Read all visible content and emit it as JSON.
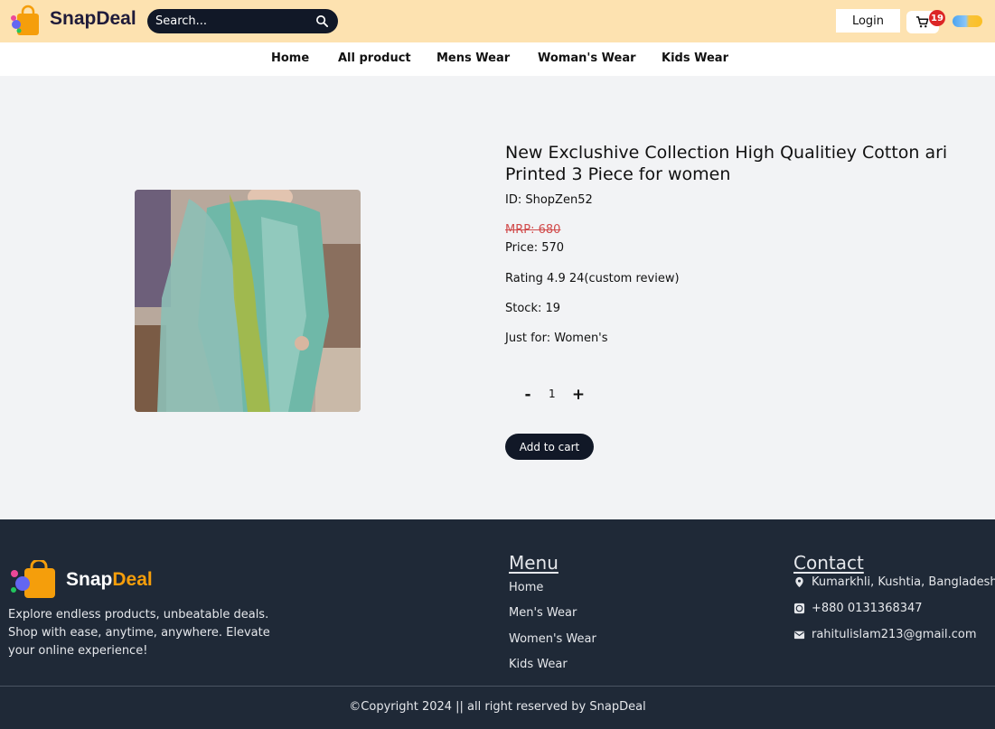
{
  "header": {
    "brand": "SnapDeal",
    "search_placeholder": "Search...",
    "login_label": "Login",
    "cart_count": "19",
    "colors": {
      "background": "#fde2b0",
      "search_bg": "#111827",
      "badge": "#dc2626"
    }
  },
  "nav": {
    "items": [
      {
        "label": "Home"
      },
      {
        "label": "All product"
      },
      {
        "label": "Mens Wear"
      },
      {
        "label": "Woman's Wear"
      },
      {
        "label": "Kids Wear"
      }
    ]
  },
  "product": {
    "title": "New Exclushive Collection High Qualitiey Cotton ari Printed 3 Piece for women",
    "id": "ID: ShopZen52",
    "mrp": "MRP: 680",
    "price": "Price: 570",
    "rating": "Rating 4.9 24(custom review)",
    "stock": "Stock: 19",
    "just_for": "Just for: Women's",
    "qty_minus": "-",
    "qty_value": "1",
    "qty_plus": "+",
    "add_to_cart": "Add to cart",
    "image_icon": "product-photo"
  },
  "footer": {
    "brand_snap": "Snap",
    "brand_deal": "Deal",
    "description": "Explore endless products, unbeatable deals. Shop with ease, anytime, anywhere. Elevate your online experience!",
    "menu_heading": "Menu",
    "menu_items": [
      {
        "label": "Home"
      },
      {
        "label": "Men's Wear"
      },
      {
        "label": "Women's Wear"
      },
      {
        "label": "Kids Wear"
      }
    ],
    "contact_heading": "Contact",
    "contact": {
      "address": "Kumarkhli, Kushtia, Bangladesh",
      "phone": "+880 0131368347",
      "email": "rahitulislam213@gmail.com"
    },
    "copyright": "©Copyright 2024 || all right reserved by SnapDeal",
    "colors": {
      "background": "#1f2937",
      "accent": "#f59e0b"
    }
  }
}
